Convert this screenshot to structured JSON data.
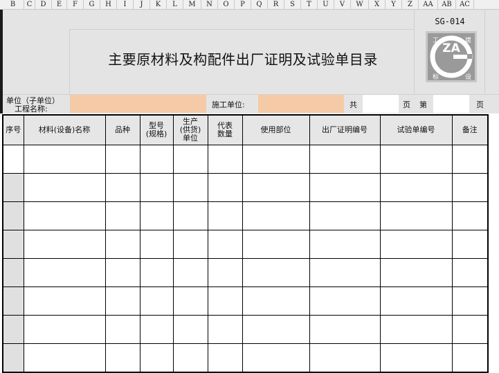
{
  "columns": [
    "B",
    "C",
    "D",
    "E",
    "F",
    "G",
    "H",
    "I",
    "J",
    "K",
    "L",
    "M",
    "N",
    "O",
    "P",
    "Q",
    "R",
    "S",
    "T",
    "U",
    "V",
    "W",
    "X",
    "Y",
    "Z",
    "AA",
    "AB",
    "AC"
  ],
  "form": {
    "code": "SG-014",
    "title": "主要原材料及构配件出厂证明及试验单目录",
    "logo": {
      "center": "ZA",
      "tl": "工",
      "tr": "建",
      "bl": "标",
      "br": "设"
    }
  },
  "info": {
    "unit_label_line1": "单位（子单位）",
    "unit_label_line2": "工程名称:",
    "contractor_label": "施工单位:",
    "total_label": "共",
    "page_unit_1": "页",
    "page_label": "第",
    "page_unit_2": "页"
  },
  "table": {
    "headers": [
      "序号",
      "材料(设备)名称",
      "品种",
      "型号\n(规格)",
      "生产\n(供货)\n单位",
      "代表\n数量",
      "使用部位",
      "出厂证明编号",
      "试验单编号",
      "备注"
    ],
    "rows": [
      [
        "",
        "",
        "",
        "",
        "",
        "",
        "",
        "",
        "",
        ""
      ],
      [
        "",
        "",
        "",
        "",
        "",
        "",
        "",
        "",
        "",
        ""
      ],
      [
        "",
        "",
        "",
        "",
        "",
        "",
        "",
        "",
        "",
        ""
      ],
      [
        "",
        "",
        "",
        "",
        "",
        "",
        "",
        "",
        "",
        ""
      ],
      [
        "",
        "",
        "",
        "",
        "",
        "",
        "",
        "",
        "",
        ""
      ],
      [
        "",
        "",
        "",
        "",
        "",
        "",
        "",
        "",
        "",
        ""
      ],
      [
        "",
        "",
        "",
        "",
        "",
        "",
        "",
        "",
        "",
        ""
      ],
      [
        "",
        "",
        "",
        "",
        "",
        "",
        "",
        "",
        "",
        ""
      ]
    ]
  }
}
